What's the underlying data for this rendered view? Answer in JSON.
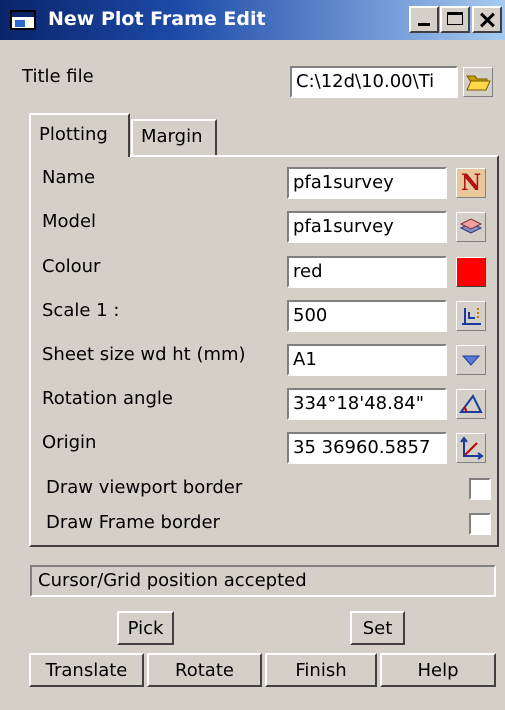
{
  "window": {
    "title": "New Plot Frame Edit"
  },
  "title_file": {
    "label": "Title file",
    "value": "C:\\12d\\10.00\\Ti"
  },
  "tabs": [
    {
      "label": "Plotting",
      "active": true
    },
    {
      "label": "Margin",
      "active": false
    }
  ],
  "fields": {
    "name": {
      "label": "Name",
      "value": "pfa1survey"
    },
    "model": {
      "label": "Model",
      "value": "pfa1survey"
    },
    "colour": {
      "label": "Colour",
      "value": "red",
      "swatch": "#ff0000"
    },
    "scale": {
      "label": "Scale 1 :",
      "value": "500"
    },
    "sheet_size": {
      "label": "Sheet size wd ht (mm)",
      "value": "A1"
    },
    "rotation": {
      "label": "Rotation angle",
      "value": "334°18'48.84\""
    },
    "origin": {
      "label": "Origin",
      "value": "35 36960.5857"
    }
  },
  "name_button_glyph": "N",
  "checkboxes": {
    "viewport_border": {
      "label": "Draw viewport border",
      "checked": false
    },
    "frame_border": {
      "label": "Draw Frame border",
      "checked": false
    }
  },
  "status": "Cursor/Grid position accepted",
  "buttons": {
    "pick": "Pick",
    "set": "Set",
    "translate": "Translate",
    "rotate": "Rotate",
    "finish": "Finish",
    "help": "Help"
  },
  "icons": {
    "folder": "folder-icon",
    "name_button": "name-n-icon",
    "model_button": "layers-icon",
    "sheet_dropdown": "chevron-down-icon",
    "scale_pick": "scale-icon",
    "rotation_pick": "angle-icon",
    "origin_pick": "axes-icon"
  }
}
